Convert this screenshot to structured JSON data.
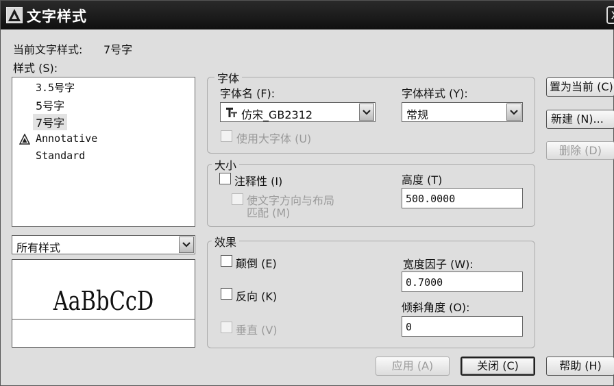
{
  "window": {
    "title": "文字样式",
    "close_label": "X"
  },
  "current": {
    "label": "当前文字样式:",
    "value": "7号字"
  },
  "styles": {
    "label": "样式 (S):",
    "items": [
      "3.5号字",
      "5号字",
      "7号字",
      "Annotative",
      "Standard"
    ],
    "selected": "7号字",
    "filter_value": "所有样式"
  },
  "preview": {
    "sample": "AaBbCcD"
  },
  "font": {
    "group_label": "字体",
    "name_label": "字体名 (F):",
    "name_value": "仿宋_GB2312",
    "style_label": "字体样式 (Y):",
    "style_value": "常规",
    "bigfont_label": "使用大字体 (U)"
  },
  "size": {
    "group_label": "大小",
    "annotative_label": "注释性 (I)",
    "match_line1": "使文字方向与布局",
    "match_line2": "匹配 (M)",
    "height_label": "高度 (T)",
    "height_value": "500.0000"
  },
  "effects": {
    "group_label": "效果",
    "upside_down_label": "颠倒 (E)",
    "backwards_label": "反向 (K)",
    "vertical_label": "垂直 (V)",
    "width_factor_label": "宽度因子 (W):",
    "width_factor_value": "0.7000",
    "oblique_label": "倾斜角度 (O):",
    "oblique_value": "0"
  },
  "buttons": {
    "set_current": "置为当前 (C)",
    "new": "新建 (N)...",
    "delete": "删除 (D)",
    "apply": "应用 (A)",
    "close": "关闭 (C)",
    "help": "帮助 (H)"
  }
}
